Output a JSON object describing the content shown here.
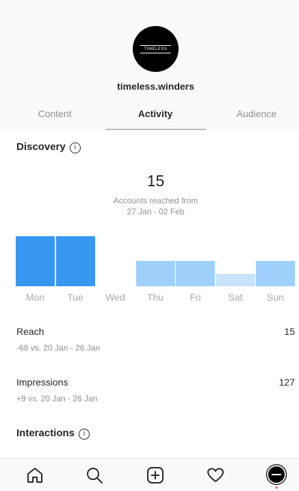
{
  "header": {
    "logo_text": "TIMELESS",
    "username": "timeless.winders"
  },
  "tabs": [
    {
      "label": "Content",
      "active": false
    },
    {
      "label": "Activity",
      "active": true
    },
    {
      "label": "Audience",
      "active": false
    }
  ],
  "discovery": {
    "title": "Discovery",
    "info_icon": "ⓘ",
    "accounts_reached": "15",
    "caption_line1": "Accounts reached from",
    "caption_line2": "27 Jan - 02 Feb"
  },
  "chart_data": {
    "type": "bar",
    "categories": [
      "Mon",
      "Tue",
      "Wed",
      "Thu",
      "Fri",
      "Sat",
      "Sun"
    ],
    "values": [
      1.0,
      1.0,
      0.0,
      0.5,
      0.5,
      0.25,
      0.5
    ],
    "value_scale": "relative (tallest bar = 1.0); no axis printed",
    "highlighted": [
      true,
      true,
      false,
      false,
      false,
      false,
      false
    ]
  },
  "metrics": [
    {
      "label": "Reach",
      "value": "15",
      "comparison": "-68 vs. 20 Jan - 26 Jan"
    },
    {
      "label": "Impressions",
      "value": "127",
      "comparison": "+9 vs. 20 Jan - 26 Jan"
    }
  ],
  "interactions": {
    "title": "Interactions",
    "info_icon": "ⓘ"
  },
  "nav": {
    "icons": [
      "home-icon",
      "search-icon",
      "new-post-icon",
      "activity-heart-icon",
      "profile-avatar"
    ]
  },
  "colors": {
    "bar_highlight": "#3897f0",
    "bar_normal": "#9fd0fb",
    "bar_light": "#c7e3fd",
    "muted_text": "#8e8e8e"
  }
}
